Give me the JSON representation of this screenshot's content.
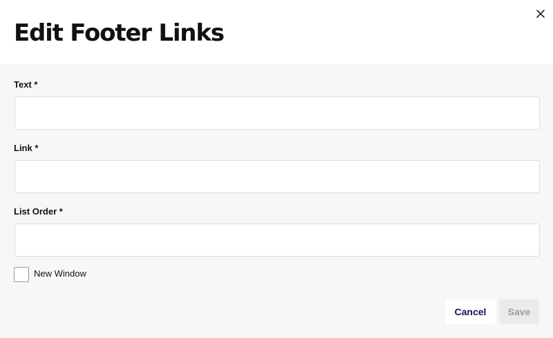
{
  "dialog": {
    "title": "Edit Footer Links",
    "close_icon": "close-icon"
  },
  "form": {
    "text_field": {
      "label": "Text *",
      "value": "",
      "placeholder": ""
    },
    "link_field": {
      "label": "Link *",
      "value": "",
      "placeholder": ""
    },
    "list_order_field": {
      "label": "List Order *",
      "value": "",
      "placeholder": ""
    },
    "new_window": {
      "label": "New Window",
      "checked": false
    }
  },
  "actions": {
    "cancel_label": "Cancel",
    "save_label": "Save",
    "save_enabled": false
  },
  "colors": {
    "header_bg": "#ffffff",
    "body_bg": "#f7f7f7",
    "cancel_text": "#14115c",
    "save_disabled_bg": "#ebebeb",
    "save_disabled_text": "#9b9b9b"
  }
}
